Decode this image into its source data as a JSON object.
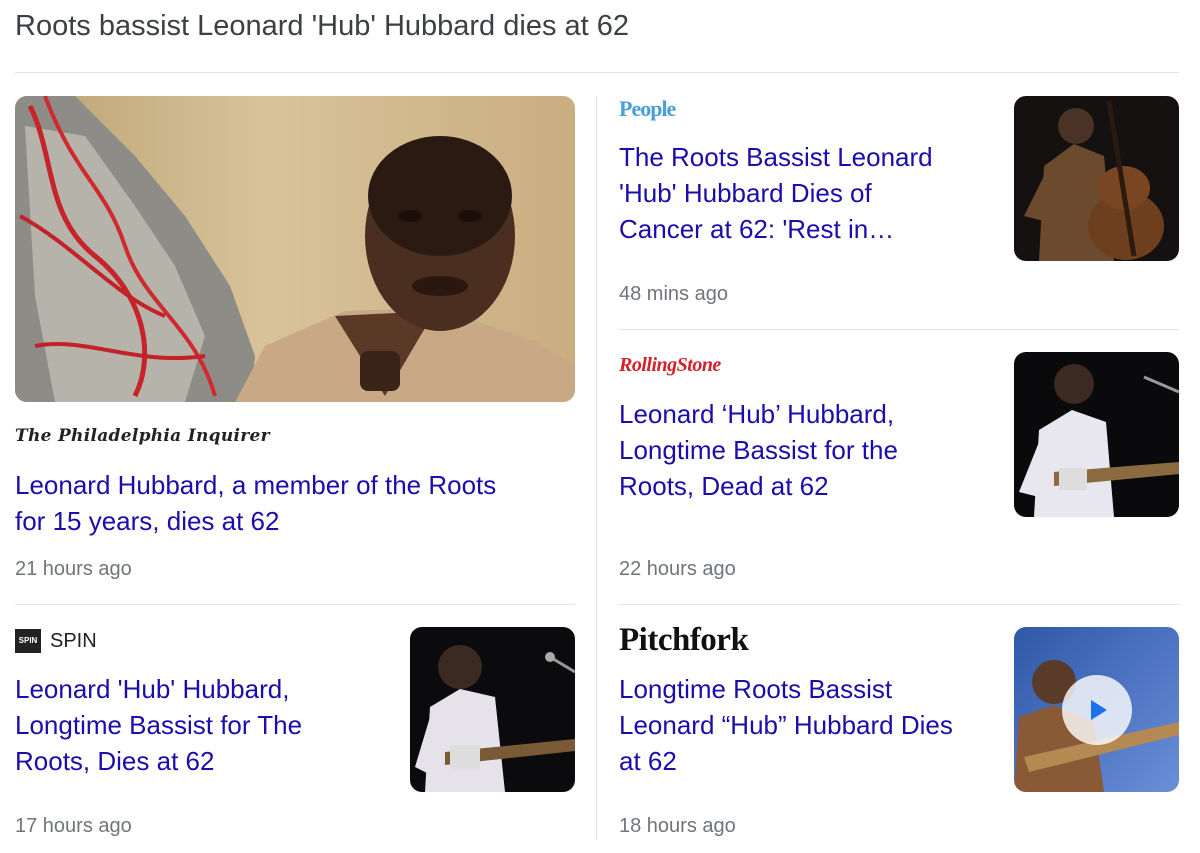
{
  "heading": "Roots bassist Leonard 'Hub' Hubbard dies at 62",
  "stories": {
    "inquirer": {
      "source": "The Philadelphia Inquirer",
      "title_line1": "Leonard Hubbard, a member of the Roots",
      "title_line2": "for 15 years, dies at 62",
      "time": "21 hours ago"
    },
    "people": {
      "source": "People",
      "title_line1": "The Roots Bassist Leonard",
      "title_line2": "'Hub' Hubbard Dies of",
      "title_line3": "Cancer at 62: 'Rest in…",
      "time": "48 mins ago"
    },
    "rollingstone": {
      "source": "RollingStone",
      "title_line1": "Leonard ‘Hub’ Hubbard,",
      "title_line2": "Longtime Bassist for the",
      "title_line3": "Roots, Dead at 62",
      "time": "22 hours ago"
    },
    "spin": {
      "source": "SPIN",
      "logo_text": "SPIN",
      "title_line1": "Leonard 'Hub' Hubbard,",
      "title_line2": "Longtime Bassist for The",
      "title_line3": "Roots, Dies at 62",
      "time": "17 hours ago"
    },
    "pitchfork": {
      "source": "Pitchfork",
      "title_line1": "Longtime Roots Bassist",
      "title_line2": "Leonard “Hub” Hubbard Dies",
      "title_line3": "at 62",
      "time": "18 hours ago",
      "video_icon": "play-icon"
    }
  },
  "colors": {
    "link": "#1a0dab",
    "meta": "#70757a",
    "divider": "#e3e3e3"
  }
}
